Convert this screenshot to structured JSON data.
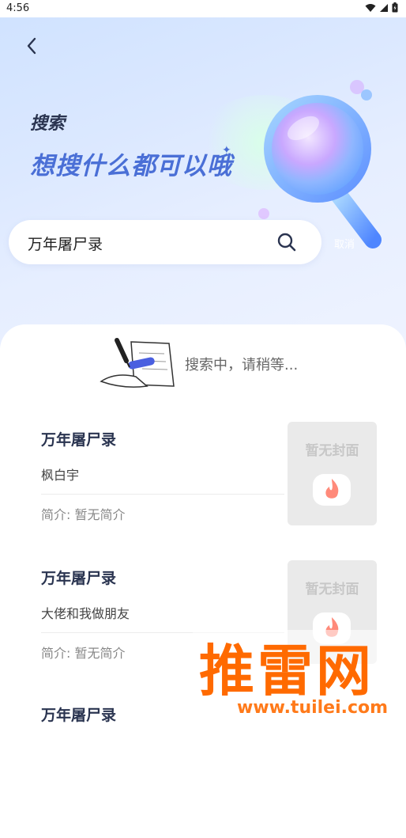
{
  "status_bar": {
    "time": "4:56"
  },
  "header": {
    "title": "搜索",
    "subtitle": "想搜什么都可以哦"
  },
  "search": {
    "value": "万年屠尸录",
    "cancel_label": "取消"
  },
  "loading": {
    "text": "搜索中，请稍等..."
  },
  "results": [
    {
      "title": "万年屠尸录",
      "author": "枫白宇",
      "intro": "简介: 暂无简介",
      "cover_text": "暂无封面"
    },
    {
      "title": "万年屠尸录",
      "author": "大佬和我做朋友",
      "intro": "简介: 暂无简介",
      "cover_text": "暂无封面"
    },
    {
      "title": "万年屠尸录"
    }
  ],
  "watermark": {
    "brand": "推雷网",
    "url": "www.tuilei.com"
  },
  "colors": {
    "accent": "#4a6fd6",
    "title_dark": "#2a3450",
    "watermark": "#ff6a00"
  }
}
